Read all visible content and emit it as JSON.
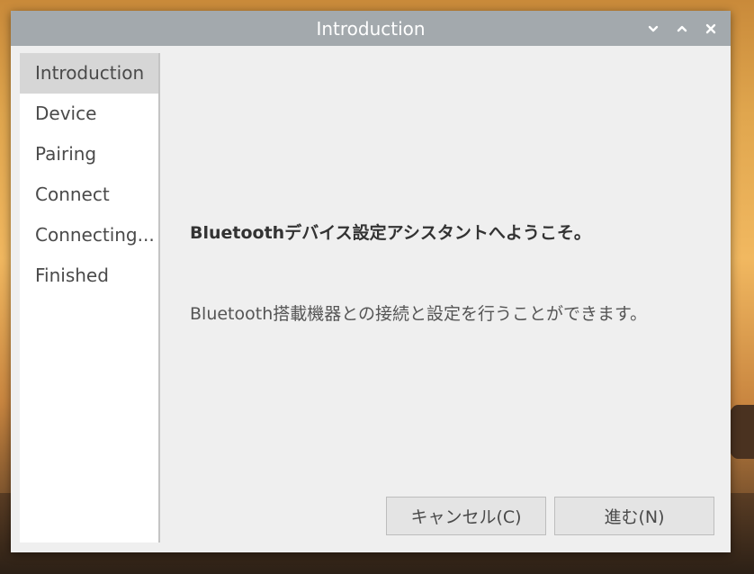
{
  "window": {
    "title": "Introduction"
  },
  "title_controls": {
    "minimize_icon": "chevron-down-icon",
    "maximize_icon": "chevron-up-icon",
    "close_icon": "close-icon"
  },
  "sidebar": {
    "selected_index": 0,
    "items": [
      {
        "label": "Introduction"
      },
      {
        "label": "Device"
      },
      {
        "label": "Pairing"
      },
      {
        "label": "Connect"
      },
      {
        "label": "Connecting..."
      },
      {
        "label": "Finished"
      }
    ]
  },
  "content": {
    "heading": "Bluetoothデバイス設定アシスタントへようこそ。",
    "description": "Bluetooth搭載機器との接続と設定を行うことができます。"
  },
  "buttons": {
    "cancel_label": "キャンセル(C)",
    "next_label": "進む(N)"
  },
  "colors": {
    "titlebar": "#a3a9ad",
    "window_bg": "#efefef",
    "sidebar_selected": "#d6d6d6"
  }
}
